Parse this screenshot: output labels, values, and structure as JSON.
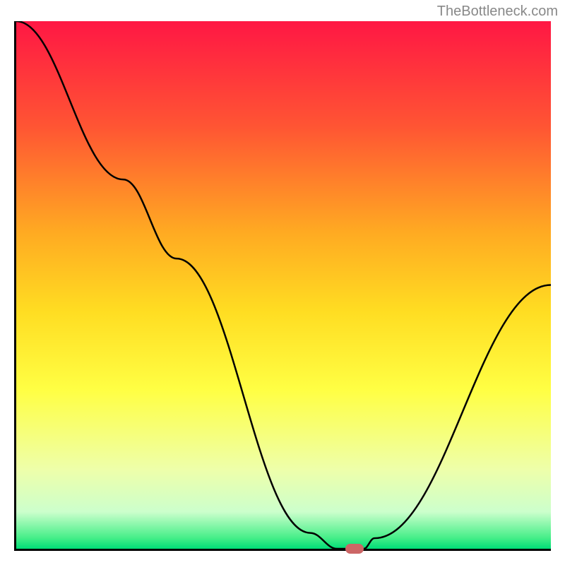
{
  "watermark": "TheBottleneck.com",
  "chart_data": {
    "type": "line",
    "title": "",
    "xlabel": "",
    "ylabel": "",
    "xlim": [
      0,
      100
    ],
    "ylim": [
      0,
      100
    ],
    "curve_points": [
      {
        "x": 0,
        "y": 100
      },
      {
        "x": 20,
        "y": 70
      },
      {
        "x": 30,
        "y": 55
      },
      {
        "x": 55,
        "y": 3
      },
      {
        "x": 60,
        "y": 0
      },
      {
        "x": 65,
        "y": 0
      },
      {
        "x": 67,
        "y": 2
      },
      {
        "x": 100,
        "y": 50
      }
    ],
    "marker": {
      "x": 63,
      "y": 0
    },
    "gradient_stops": [
      {
        "offset": 0,
        "color": "#ff1744"
      },
      {
        "offset": 20,
        "color": "#ff5533"
      },
      {
        "offset": 40,
        "color": "#ffaa22"
      },
      {
        "offset": 55,
        "color": "#ffdd22"
      },
      {
        "offset": 70,
        "color": "#ffff44"
      },
      {
        "offset": 85,
        "color": "#eeffaa"
      },
      {
        "offset": 93,
        "color": "#ccffcc"
      },
      {
        "offset": 98,
        "color": "#44ee88"
      },
      {
        "offset": 100,
        "color": "#00dd77"
      }
    ]
  }
}
